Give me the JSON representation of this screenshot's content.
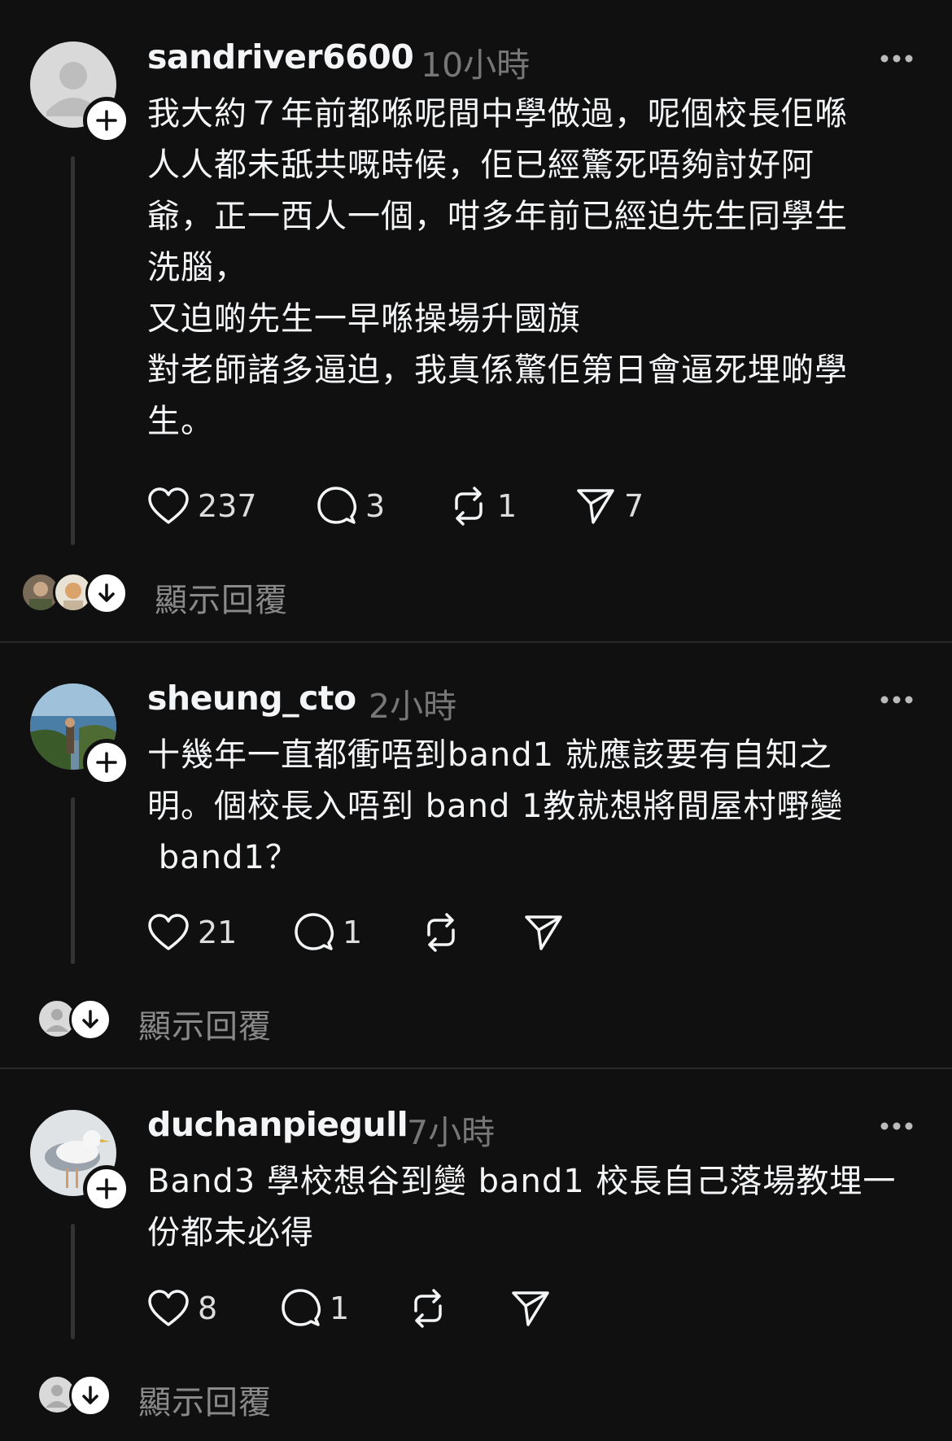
{
  "posts": [
    {
      "username": "sandriver6600",
      "time": "10小時",
      "body": "我大約７年前都喺呢間中學做過，呢個校長佢喺\n人人都未舐共嘅時候，佢已經驚死唔夠討好阿\n爺，正一西人一個，咁多年前已經迫先生同學生\n洗腦，\n又迫啲先生一早喺操場升國旗\n對老師諸多逼迫，我真係驚佢第日會逼死埋啲學\n生。",
      "likes": "237",
      "comments": "3",
      "reposts": "1",
      "shares": "7",
      "show_replies": "顯示回覆"
    },
    {
      "username": "sheung_cto",
      "time": "2小時",
      "body": "十幾年一直都衝唔到band1 就應該要有自知之\n明。個校長入唔到 band 1教就想將間屋村嘢變\n band1？",
      "likes": "21",
      "comments": "1",
      "reposts": "",
      "shares": "",
      "show_replies": "顯示回覆"
    },
    {
      "username": "duchanpiegull",
      "time": "7小時",
      "body": "Band3 學校想谷到變 band1 校長自己落場教埋一\n份都未必得",
      "likes": "8",
      "comments": "1",
      "reposts": "",
      "shares": "",
      "show_replies": "顯示回覆"
    }
  ],
  "icons": {
    "like": "heart-icon",
    "comment": "comment-bubble-icon",
    "repost": "repost-icon",
    "share": "send-icon",
    "more": "more-dots-icon",
    "follow": "plus-icon",
    "expand": "arrow-down-icon"
  },
  "colors": {
    "background": "#101010",
    "text": "#f3f5f7",
    "muted": "#777777",
    "divider": "#2a2a2a"
  }
}
